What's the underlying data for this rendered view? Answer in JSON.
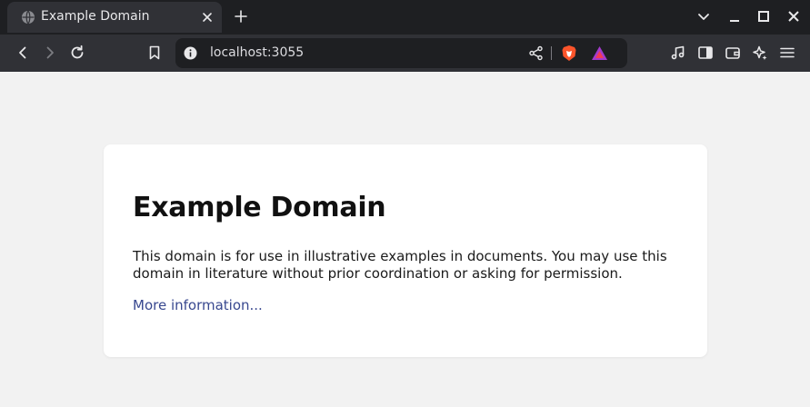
{
  "browser": {
    "tab": {
      "title": "Example Domain"
    },
    "address_bar": {
      "url": "localhost:3055"
    }
  },
  "page": {
    "heading": "Example Domain",
    "paragraph": "This domain is for use in illustrative examples in documents. You may use this domain in literature without prior coordination or asking for permission.",
    "link_text": "More information..."
  },
  "colors": {
    "titlebar_bg": "#1e1f22",
    "toolbar_bg": "#303136",
    "page_bg": "#f2f2f2",
    "card_bg": "#ffffff",
    "link": "#38488f",
    "brave_orange": "#fb542b"
  }
}
